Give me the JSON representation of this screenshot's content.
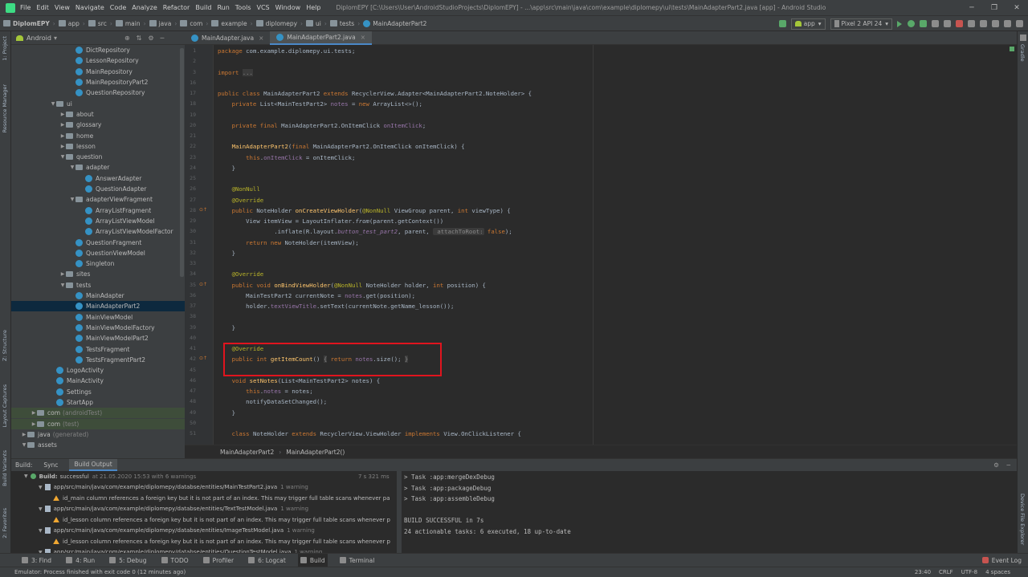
{
  "menu": {
    "items": [
      "File",
      "Edit",
      "View",
      "Navigate",
      "Code",
      "Analyze",
      "Refactor",
      "Build",
      "Run",
      "Tools",
      "VCS",
      "Window",
      "Help"
    ],
    "window_title": "DiplomEPY [C:\\Users\\User\\AndroidStudioProjects\\DiplomEPY] - ...\\app\\src\\main\\java\\com\\example\\diplomepy\\ui\\tests\\MainAdapterPart2.java [app] - Android Studio"
  },
  "nav": {
    "crumbs": [
      "DiplomEPY",
      "app",
      "src",
      "main",
      "java",
      "com",
      "example",
      "diplomepy",
      "ui",
      "tests",
      "MainAdapterPart2"
    ],
    "run_config": "app",
    "device": "Pixel 2 API 24"
  },
  "leftstrip": {
    "project": "1: Project",
    "resource_manager": "Resource Manager",
    "structure": "Z: Structure",
    "layout_captures": "Layout Captures",
    "build_variants": "Build Variants",
    "favorites": "2: Favorites"
  },
  "rightstrip": {
    "gradle": "Gradle",
    "device_file_explorer": "Device File Explorer"
  },
  "project": {
    "view": "Android",
    "tree": [
      {
        "label": "DictRepository",
        "depth": 6,
        "kind": "class"
      },
      {
        "label": "LessonRepository",
        "depth": 6,
        "kind": "class"
      },
      {
        "label": "MainRepository",
        "depth": 6,
        "kind": "class"
      },
      {
        "label": "MainRepositoryPart2",
        "depth": 6,
        "kind": "class"
      },
      {
        "label": "QuestionRepository",
        "depth": 6,
        "kind": "class"
      },
      {
        "label": "ui",
        "depth": 4,
        "kind": "folder",
        "arrow": "▼"
      },
      {
        "label": "about",
        "depth": 5,
        "kind": "folder",
        "arrow": "▶"
      },
      {
        "label": "glossary",
        "depth": 5,
        "kind": "folder",
        "arrow": "▶"
      },
      {
        "label": "home",
        "depth": 5,
        "kind": "folder",
        "arrow": "▶"
      },
      {
        "label": "lesson",
        "depth": 5,
        "kind": "folder",
        "arrow": "▶"
      },
      {
        "label": "question",
        "depth": 5,
        "kind": "folder",
        "arrow": "▼"
      },
      {
        "label": "adapter",
        "depth": 6,
        "kind": "folder",
        "arrow": "▼"
      },
      {
        "label": "AnswerAdapter",
        "depth": 7,
        "kind": "class"
      },
      {
        "label": "QuestionAdapter",
        "depth": 7,
        "kind": "class"
      },
      {
        "label": "adapterViewFragment",
        "depth": 6,
        "kind": "folder",
        "arrow": "▼"
      },
      {
        "label": "ArrayListFragment",
        "depth": 7,
        "kind": "class"
      },
      {
        "label": "ArrayListViewModel",
        "depth": 7,
        "kind": "class"
      },
      {
        "label": "ArrayListViewModelFactor",
        "depth": 7,
        "kind": "class"
      },
      {
        "label": "QuestionFragment",
        "depth": 6,
        "kind": "class"
      },
      {
        "label": "QuestionViewModel",
        "depth": 6,
        "kind": "class"
      },
      {
        "label": "Singleton",
        "depth": 6,
        "kind": "class"
      },
      {
        "label": "sites",
        "depth": 5,
        "kind": "folder",
        "arrow": "▶"
      },
      {
        "label": "tests",
        "depth": 5,
        "kind": "folder",
        "arrow": "▼"
      },
      {
        "label": "MainAdapter",
        "depth": 6,
        "kind": "class"
      },
      {
        "label": "MainAdapterPart2",
        "depth": 6,
        "kind": "class",
        "selected": true
      },
      {
        "label": "MainViewModel",
        "depth": 6,
        "kind": "class"
      },
      {
        "label": "MainViewModelFactory",
        "depth": 6,
        "kind": "class"
      },
      {
        "label": "MainViewModelPart2",
        "depth": 6,
        "kind": "class"
      },
      {
        "label": "TestsFragment",
        "depth": 6,
        "kind": "class"
      },
      {
        "label": "TestsFragmentPart2",
        "depth": 6,
        "kind": "class"
      },
      {
        "label": "LogoActivity",
        "depth": 4,
        "kind": "class"
      },
      {
        "label": "MainActivity",
        "depth": 4,
        "kind": "class"
      },
      {
        "label": "Settings",
        "depth": 4,
        "kind": "class"
      },
      {
        "label": "StartApp",
        "depth": 4,
        "kind": "class"
      },
      {
        "label": "com",
        "suffix": "(androidTest)",
        "depth": 2,
        "kind": "folder",
        "arrow": "▶",
        "shade": true
      },
      {
        "label": "com",
        "suffix": "(test)",
        "depth": 2,
        "kind": "folder",
        "arrow": "▶",
        "shade": true
      },
      {
        "label": "java",
        "suffix": "(generated)",
        "depth": 1,
        "kind": "folder",
        "arrow": "▶"
      },
      {
        "label": "assets",
        "depth": 1,
        "kind": "folder",
        "arrow": "▼"
      }
    ]
  },
  "editor": {
    "tabs": [
      {
        "label": "MainAdapter.java",
        "active": false
      },
      {
        "label": "MainAdapterPart2.java",
        "active": true
      }
    ],
    "breadcrumb": [
      "MainAdapterPart2",
      "MainAdapterPart2()"
    ],
    "lines": [
      {
        "n": "1",
        "h": "<span class='k'>package</span> com.example.diplomepy.ui.tests;"
      },
      {
        "n": "2",
        "h": ""
      },
      {
        "n": "3",
        "h": "<span class='k'>import</span> <span class='im'>...</span>"
      },
      {
        "n": "16",
        "h": ""
      },
      {
        "n": "17",
        "h": "<span class='k'>public class</span> MainAdapterPart2 <span class='k'>extends</span> RecyclerView.Adapter&lt;MainAdapterPart2.NoteHolder&gt; {"
      },
      {
        "n": "18",
        "h": "    <span class='k'>private</span> List&lt;MainTestPart2&gt; <span class='fld'>notes</span> = <span class='k'>new</span> ArrayList&lt;&gt;();"
      },
      {
        "n": "19",
        "h": ""
      },
      {
        "n": "20",
        "h": "    <span class='k'>private final</span> MainAdapterPart2.OnItemClick <span class='fld'>onItemClick</span>;"
      },
      {
        "n": "21",
        "h": ""
      },
      {
        "n": "22",
        "h": "    <span class='f'>MainAdapterPart2</span>(<span class='k'>final</span> MainAdapterPart2.OnItemClick onItemClick) {"
      },
      {
        "n": "23",
        "h": "        <span class='k'>this</span>.<span class='fld'>onItemClick</span> = onItemClick;"
      },
      {
        "n": "24",
        "h": "    }"
      },
      {
        "n": "25",
        "h": ""
      },
      {
        "n": "26",
        "h": "    <span class='a'>@NonNull</span>"
      },
      {
        "n": "27",
        "h": "    <span class='a'>@Override</span>"
      },
      {
        "n": "28",
        "h": "    <span class='k'>public</span> NoteHolder <span class='f'>onCreateViewHolder</span>(<span class='a'>@NonNull</span> ViewGroup parent, <span class='k'>int</span> viewType) {"
      },
      {
        "n": "29",
        "h": "        View itemView = LayoutInflater.<span style='font-style:italic'>from</span>(parent.getContext())"
      },
      {
        "n": "30",
        "h": "                .inflate(R.layout.<span class='i'>button_test_part2</span>, parent, <span class='hint'> attachToRoot:</span> <span class='k'>false</span>);"
      },
      {
        "n": "31",
        "h": "        <span class='k'>return new</span> NoteHolder(itemView);"
      },
      {
        "n": "32",
        "h": "    }"
      },
      {
        "n": "33",
        "h": ""
      },
      {
        "n": "34",
        "h": "    <span class='a'>@Override</span>"
      },
      {
        "n": "35",
        "h": "    <span class='k'>public void</span> <span class='f'>onBindViewHolder</span>(<span class='a'>@NonNull</span> NoteHolder holder, <span class='k'>int</span> position) {"
      },
      {
        "n": "36",
        "h": "        MainTestPart2 currentNote = <span class='fld'>notes</span>.get(position);"
      },
      {
        "n": "37",
        "h": "        holder.<span class='fld'>textViewTitle</span>.setText(currentNote.getName_lesson());"
      },
      {
        "n": "38",
        "h": ""
      },
      {
        "n": "39",
        "h": "    }"
      },
      {
        "n": "40",
        "h": ""
      },
      {
        "n": "41",
        "h": "    <span class='a'>@Override</span>"
      },
      {
        "n": "42",
        "h": "    <span class='k'>public int</span> <span class='f'>getItemCount</span>() <span class='im'>{</span> <span class='k'>return</span> <span class='fld'>notes</span>.size(); <span class='im'>}</span>"
      },
      {
        "n": "45",
        "h": ""
      },
      {
        "n": "46",
        "h": "    <span class='k'>void</span> <span class='f'>setNotes</span>(List&lt;MainTestPart2&gt; notes) {"
      },
      {
        "n": "47",
        "h": "        <span class='k'>this</span>.<span class='fld'>notes</span> = notes;"
      },
      {
        "n": "48",
        "h": "        notifyDataSetChanged();"
      },
      {
        "n": "49",
        "h": "    }"
      },
      {
        "n": "50",
        "h": ""
      },
      {
        "n": "51",
        "h": "    <span class='k'>class</span> NoteHolder <span class='k'>extends</span> RecyclerView.ViewHolder <span class='k'>implements</span> View.OnClickListener {"
      }
    ],
    "gutter_marks": {
      "28": "⊙↑",
      "35": "⊙↑",
      "42": "⊙↑"
    }
  },
  "build": {
    "tabs": [
      "Build:",
      "Sync",
      "Build Output"
    ],
    "active_tab": "Build Output",
    "summary": {
      "label": "Build:",
      "status": "successful",
      "when": "at 21.05.2020 15:53 with 6 warnings",
      "duration": "7 s 321 ms"
    },
    "rows": [
      {
        "type": "file",
        "text": "app/src/main/java/com/example/diplomepy/databse/entities/MainTestPart2.java",
        "note": "1 warning"
      },
      {
        "type": "warn",
        "text": "id_main column references a foreign key but it is not part of an index. This may trigger full table scans whenever pa"
      },
      {
        "type": "file",
        "text": "app/src/main/java/com/example/diplomepy/databse/entities/TextTestModel.java",
        "note": "1 warning"
      },
      {
        "type": "warn",
        "text": "id_lesson column references a foreign key but it is not part of an index. This may trigger full table scans whenever p"
      },
      {
        "type": "file",
        "text": "app/src/main/java/com/example/diplomepy/databse/entities/ImageTestModel.java",
        "note": "1 warning"
      },
      {
        "type": "warn",
        "text": "id_lesson column references a foreign key but it is not part of an index. This may trigger full table scans whenever p"
      },
      {
        "type": "file",
        "text": "app/src/main/java/com/example/diplomepy/databse/entities/QuestionTestModel.java",
        "note": "1 warning"
      }
    ],
    "console": [
      "> Task :app:mergeDexDebug",
      "> Task :app:packageDebug",
      "> Task :app:assembleDebug",
      "",
      "BUILD SUCCESSFUL in 7s",
      "24 actionable tasks: 6 executed, 18 up-to-date"
    ]
  },
  "bottom_tabs": [
    {
      "label": "3: Find",
      "active": false
    },
    {
      "label": "4: Run",
      "active": false
    },
    {
      "label": "5: Debug",
      "active": false
    },
    {
      "label": "TODO",
      "active": false
    },
    {
      "label": "Profiler",
      "active": false
    },
    {
      "label": "6: Logcat",
      "active": false
    },
    {
      "label": "Build",
      "active": true
    },
    {
      "label": "Terminal",
      "active": false
    }
  ],
  "event_log": "Event Log",
  "status": {
    "message": "Emulator: Process finished with exit code 0 (12 minutes ago)",
    "position": "23:40",
    "line_sep": "CRLF",
    "encoding": "UTF-8",
    "indent": "4 spaces"
  }
}
